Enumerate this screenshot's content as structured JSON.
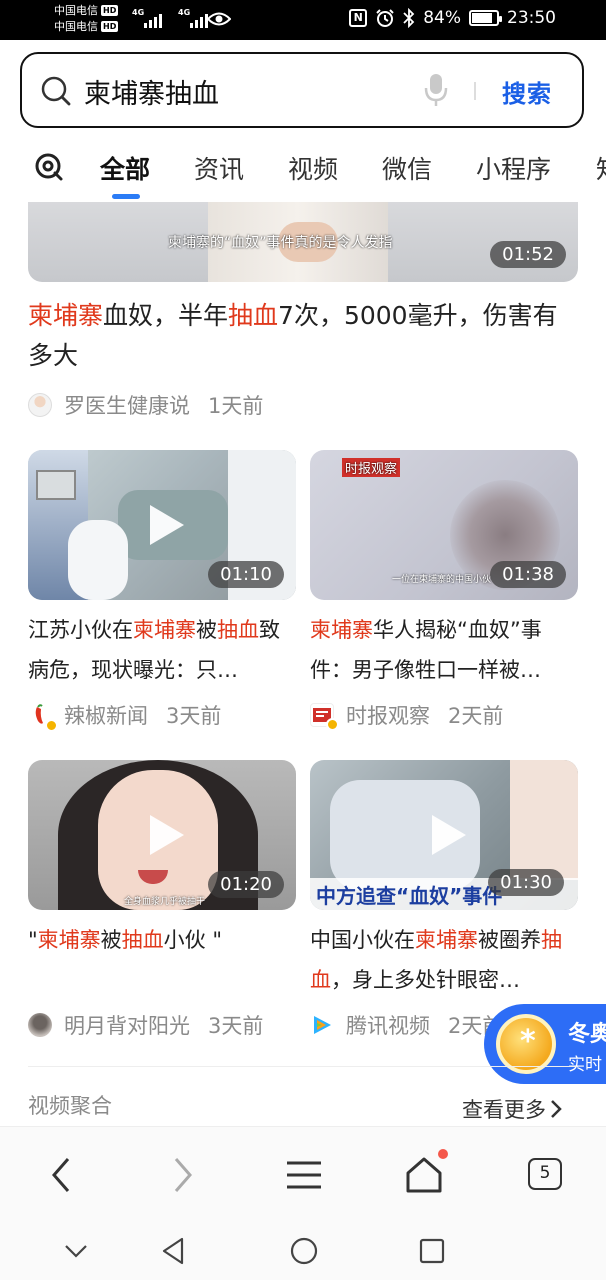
{
  "status_bar": {
    "carrier1": "中国电信",
    "carrier2": "中国电信",
    "hd": "HD",
    "net1": "4G",
    "net2": "4G",
    "nfc": "N",
    "battery": "84%",
    "battery_level": 0.84,
    "time": "23:50"
  },
  "search": {
    "query": "柬埔寨抽血",
    "button": "搜索"
  },
  "tabs": [
    {
      "label": "全部",
      "active": true
    },
    {
      "label": "资讯"
    },
    {
      "label": "视频"
    },
    {
      "label": "微信"
    },
    {
      "label": "小程序"
    },
    {
      "label": "知"
    }
  ],
  "featured": {
    "thumb_caption": "柬埔寨的“血奴”事件真的是令人发指",
    "duration": "01:52",
    "title_parts": [
      {
        "t": "柬埔寨",
        "hl": true
      },
      {
        "t": "血奴，半年"
      },
      {
        "t": "抽血",
        "hl": true
      },
      {
        "t": "7次，5000毫升，伤害有多大"
      }
    ],
    "source": "罗医生健康说",
    "time": "1天前"
  },
  "videos": [
    {
      "duration": "01:10",
      "title_parts": [
        {
          "t": "江苏小伙在"
        },
        {
          "t": "柬埔寨",
          "hl": true
        },
        {
          "t": "被"
        },
        {
          "t": "抽血",
          "hl": true
        },
        {
          "t": "致病危，现状曝光：只…"
        }
      ],
      "source": "辣椒新闻",
      "time": "3天前"
    },
    {
      "duration": "01:38",
      "thumb_logo": "时报观察",
      "thumb_caption": "一位在柬埔寨的中国小伙",
      "title_parts": [
        {
          "t": "柬埔寨",
          "hl": true
        },
        {
          "t": "华人揭秘“血奴”事件：男子像牲口一样被…"
        }
      ],
      "source": "时报观察",
      "time": "2天前"
    },
    {
      "duration": "01:20",
      "thumb_caption": "全身血浆几乎被抽干",
      "title_parts": [
        {
          "t": "\""
        },
        {
          "t": "柬埔寨",
          "hl": true
        },
        {
          "t": "被"
        },
        {
          "t": "抽血",
          "hl": true
        },
        {
          "t": "小伙 \""
        }
      ],
      "source": "明月背对阳光",
      "time": "3天前"
    },
    {
      "duration": "01:30",
      "thumb_banner": "中方追查“血奴”事件",
      "title_parts": [
        {
          "t": "中国小伙在"
        },
        {
          "t": "柬埔寨",
          "hl": true
        },
        {
          "t": "被圈养"
        },
        {
          "t": "抽血",
          "hl": true
        },
        {
          "t": "，身上多处针眼密…"
        }
      ],
      "source": "腾讯视频",
      "time": "2天前"
    }
  ],
  "promo": {
    "line1": "冬奥",
    "line2": "实时"
  },
  "section": {
    "title": "视频聚合",
    "see_more": "查看更多"
  },
  "browser_nav": {
    "tab_count": "5"
  }
}
